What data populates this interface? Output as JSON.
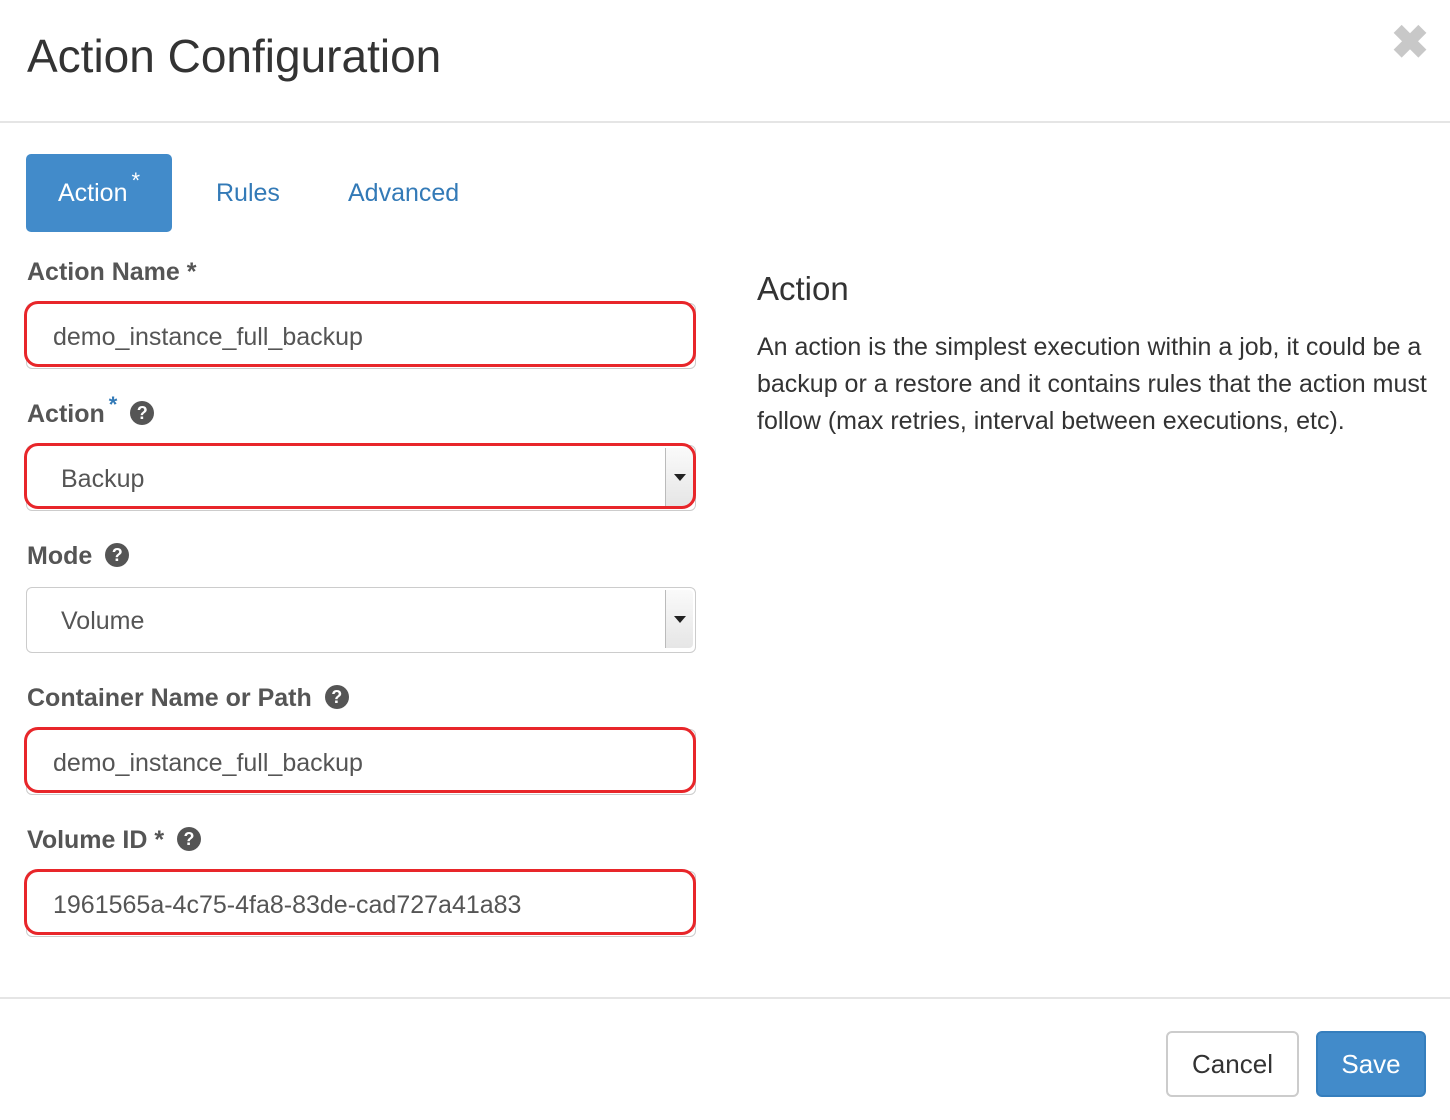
{
  "header": {
    "title": "Action Configuration",
    "close_glyph": "✖"
  },
  "tabs": [
    {
      "label": "Action",
      "required_marker": "*",
      "active": true
    },
    {
      "label": "Rules",
      "active": false
    },
    {
      "label": "Advanced",
      "active": false
    }
  ],
  "form": {
    "action_name": {
      "label": "Action Name",
      "required_marker": "*",
      "value": "demo_instance_full_backup"
    },
    "action": {
      "label": "Action",
      "required_marker": "*",
      "selected": "Backup"
    },
    "mode": {
      "label": "Mode",
      "selected": "Volume"
    },
    "container": {
      "label": "Container Name or Path",
      "value": "demo_instance_full_backup"
    },
    "volume_id": {
      "label": "Volume ID",
      "required_marker": "*",
      "value": "1961565a-4c75-4fa8-83de-cad727a41a83"
    }
  },
  "help_glyph": "?",
  "side": {
    "title": "Action",
    "description": "An action is the simplest execution within a job, it could be a backup or a restore and it contains rules that the action must follow (max retries, interval between executions, etc)."
  },
  "footer": {
    "cancel_label": "Cancel",
    "save_label": "Save"
  },
  "colors": {
    "primary": "#428bca",
    "link": "#337ab7",
    "highlight": "#e8262a"
  }
}
